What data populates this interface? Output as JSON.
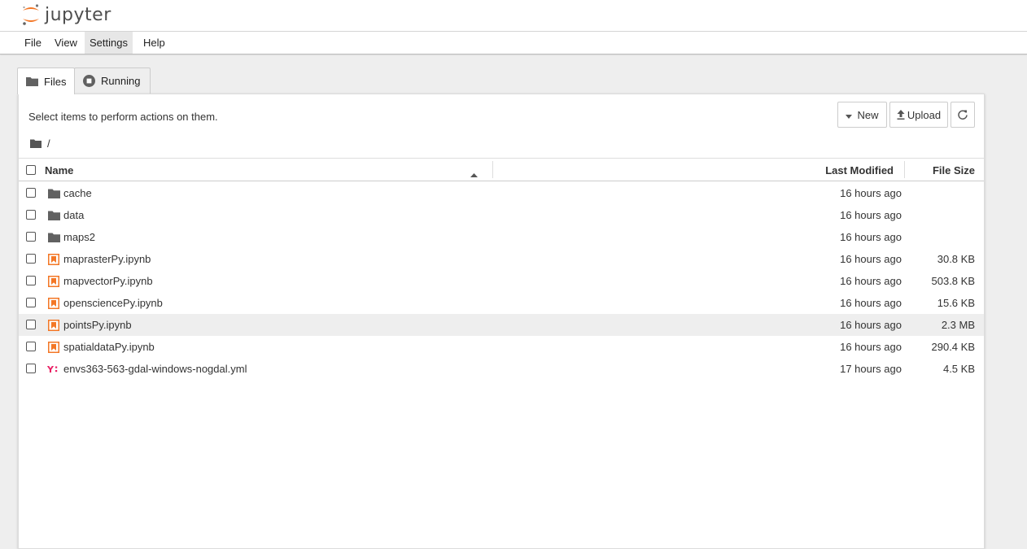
{
  "app": {
    "logo_text": "jupyter"
  },
  "menu": [
    "File",
    "View",
    "Settings",
    "Help"
  ],
  "tabs": [
    {
      "label": "Files",
      "icon": "folder-icon",
      "active": true
    },
    {
      "label": "Running",
      "icon": "running-icon",
      "active": false
    }
  ],
  "toolbar": {
    "hint": "Select items to perform actions on them.",
    "new_label": "New",
    "upload_label": "Upload",
    "refresh_icon": "refresh-icon"
  },
  "breadcrumb": {
    "path": "/"
  },
  "table": {
    "headers": {
      "name": "Name",
      "modified": "Last Modified",
      "size": "File Size"
    },
    "rows": [
      {
        "name": "cache",
        "type": "folder",
        "modified": "16 hours ago",
        "size": ""
      },
      {
        "name": "data",
        "type": "folder",
        "modified": "16 hours ago",
        "size": ""
      },
      {
        "name": "maps2",
        "type": "folder",
        "modified": "16 hours ago",
        "size": ""
      },
      {
        "name": "maprasterPy.ipynb",
        "type": "notebook",
        "modified": "16 hours ago",
        "size": "30.8 KB"
      },
      {
        "name": "mapvectorPy.ipynb",
        "type": "notebook",
        "modified": "16 hours ago",
        "size": "503.8 KB"
      },
      {
        "name": "opensciencePy.ipynb",
        "type": "notebook",
        "modified": "16 hours ago",
        "size": "15.6 KB"
      },
      {
        "name": "pointsPy.ipynb",
        "type": "notebook",
        "modified": "16 hours ago",
        "size": "2.3 MB"
      },
      {
        "name": "spatialdataPy.ipynb",
        "type": "notebook",
        "modified": "16 hours ago",
        "size": "290.4 KB"
      },
      {
        "name": "envs363-563-gdal-windows-nogdal.yml",
        "type": "yaml",
        "modified": "17 hours ago",
        "size": "4.5 KB"
      }
    ]
  },
  "colors": {
    "brand_orange": "#f37726",
    "yaml_red": "#e91e63",
    "folder_gray": "#616161"
  }
}
